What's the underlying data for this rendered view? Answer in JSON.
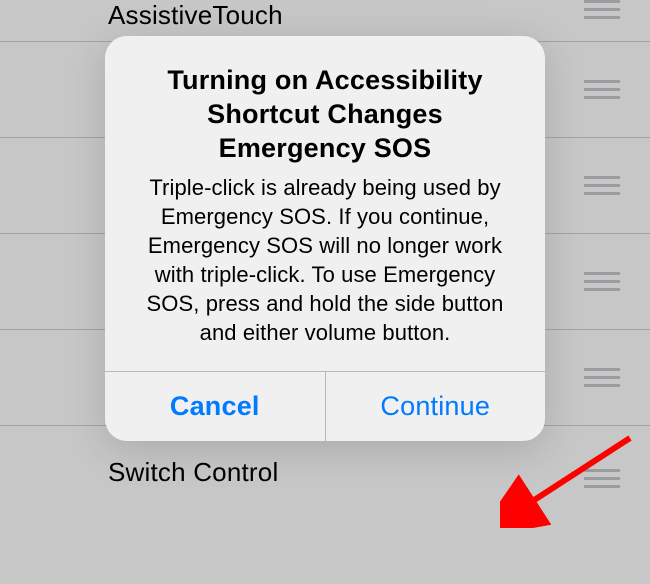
{
  "background": {
    "items": [
      {
        "label": "AssistiveTouch"
      },
      {
        "label": ""
      },
      {
        "label": ""
      },
      {
        "label": ""
      },
      {
        "label": ""
      },
      {
        "label": "Switch Control"
      }
    ]
  },
  "alert": {
    "title": "Turning on Accessibility Shortcut Changes Emergency SOS",
    "message": "Triple-click is already being used by Emergency SOS. If you continue, Emergency SOS will no longer work with triple-click. To use Emergency SOS, press and hold the side button and either volume button.",
    "cancel_label": "Cancel",
    "continue_label": "Continue"
  },
  "annotation": {
    "arrow_color": "#ff0000"
  }
}
